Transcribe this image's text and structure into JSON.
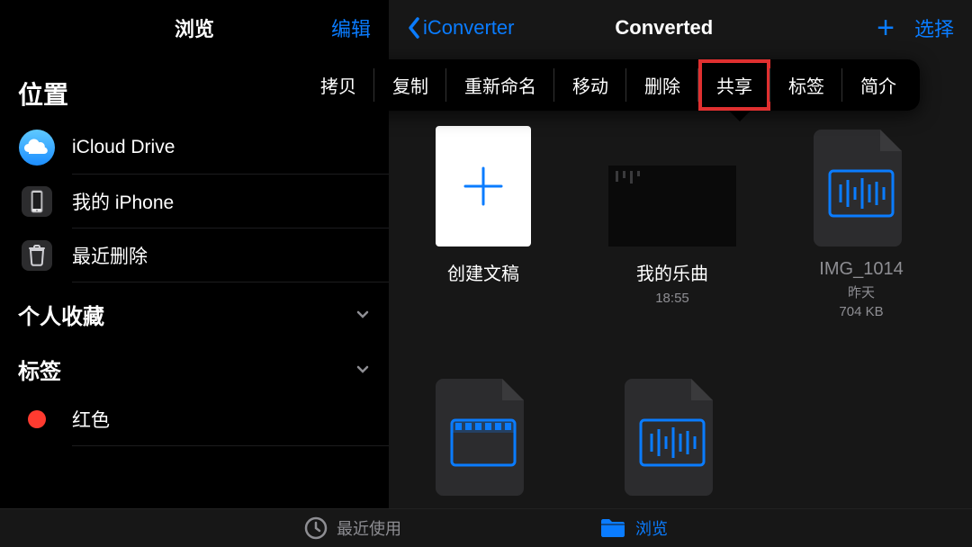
{
  "sidebar": {
    "title": "浏览",
    "edit": "编辑",
    "locations_label": "位置",
    "items": [
      {
        "label": "iCloud Drive",
        "icon": "icloud"
      },
      {
        "label": "我的 iPhone",
        "icon": "iphone"
      },
      {
        "label": "最近删除",
        "icon": "trash"
      }
    ],
    "favorites_label": "个人收藏",
    "tags_label": "标签",
    "tags": [
      {
        "label": "红色",
        "color": "#ff3b30"
      }
    ]
  },
  "main": {
    "back_label": "iConverter",
    "title": "Converted",
    "select_label": "选择",
    "context_menu": [
      {
        "label": "拷贝"
      },
      {
        "label": "复制"
      },
      {
        "label": "重新命名"
      },
      {
        "label": "移动"
      },
      {
        "label": "删除"
      },
      {
        "label": "共享",
        "highlight": true
      },
      {
        "label": "标签"
      },
      {
        "label": "简介"
      }
    ],
    "files": [
      {
        "name": "创建文稿",
        "type": "create"
      },
      {
        "name": "我的乐曲",
        "sub1": "18:55",
        "type": "music-dark"
      },
      {
        "name": "IMG_1014",
        "sub1": "昨天",
        "sub2": "704 KB",
        "dim": true,
        "type": "audio"
      },
      {
        "name": "",
        "type": "video"
      },
      {
        "name": "",
        "type": "audio"
      }
    ]
  },
  "tabs": {
    "recent": "最近使用",
    "browse": "浏览"
  }
}
